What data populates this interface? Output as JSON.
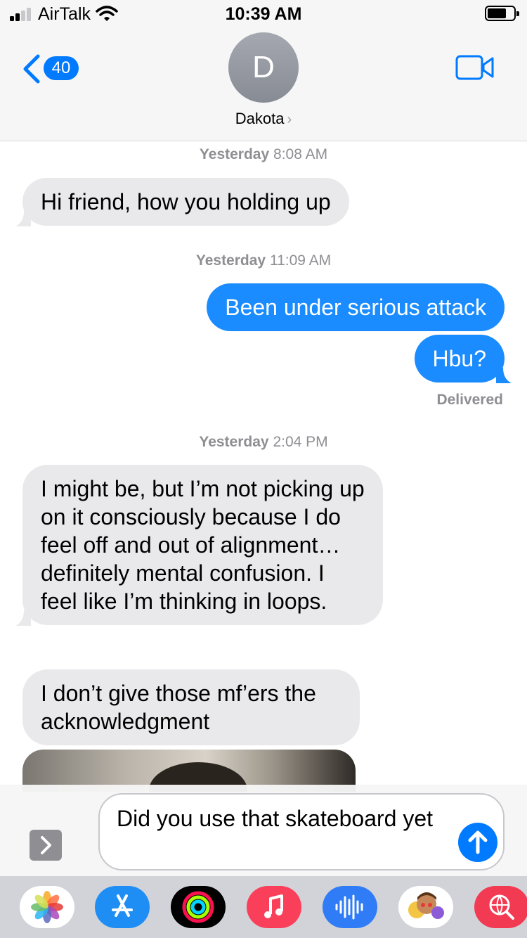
{
  "status_bar": {
    "carrier": "AirTalk",
    "time": "10:39 AM"
  },
  "header": {
    "back_count": "40",
    "avatar_initial": "D",
    "contact_name": "Dakota",
    "icons": [
      "chevron-left-icon",
      "video-camera-icon",
      "chevron-right-icon"
    ]
  },
  "thread": {
    "timestamps": [
      {
        "day": "Yesterday",
        "time": "8:08 AM"
      },
      {
        "day": "Yesterday",
        "time": "11:09 AM"
      },
      {
        "day": "Yesterday",
        "time": "2:04 PM"
      }
    ],
    "messages": [
      {
        "direction": "incoming",
        "text": "Hi friend, how you holding up"
      },
      {
        "direction": "outgoing",
        "text": "Been under serious attack"
      },
      {
        "direction": "outgoing",
        "text": "Hbu?"
      },
      {
        "direction": "incoming",
        "text": "I might be, but I’m not picking up on it consciously because I do feel off and out of alignment… definitely mental confusion. I feel like I’m thinking in loops."
      },
      {
        "direction": "incoming",
        "text": "I don’t give those mf’ers the acknowledgment"
      }
    ],
    "delivered_label": "Delivered"
  },
  "compose": {
    "value": "Did you use that skateboard yet"
  },
  "app_drawer": {
    "apps": [
      "photos-icon",
      "app-store-icon",
      "activity-icon",
      "music-icon",
      "audio-message-icon",
      "memoji-icon",
      "web-search-icon"
    ]
  },
  "colors": {
    "accent": "#007aff",
    "outgoing_bubble": "#1a8cff",
    "incoming_bubble": "#e9e9eb",
    "timestamp_gray": "#8e8e93"
  }
}
